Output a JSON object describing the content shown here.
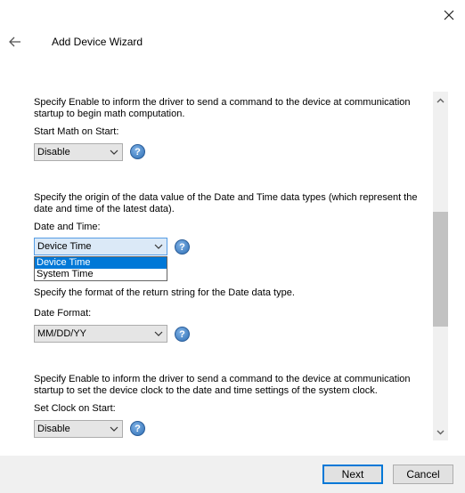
{
  "window": {
    "title": "Add Device Wizard"
  },
  "sections": [
    {
      "description": "Specify Enable to inform the driver to send a command to the device at communication startup to begin math computation.",
      "label": "Start Math on Start:",
      "value": "Disable"
    },
    {
      "description": "Specify the origin of the data value of the Date and Time data types (which represent the date and time of the latest data).",
      "label": "Date and Time:",
      "value": "Device Time",
      "options": [
        "Device Time",
        "System Time"
      ]
    },
    {
      "description": "Specify the format of the return string for the Date data type.",
      "label": "Date Format:",
      "value": "MM/DD/YY"
    },
    {
      "description": "Specify Enable to inform the driver to send a command to the device at communication startup to set the device clock to the date and time settings of the system clock.",
      "label": "Set Clock on Start:",
      "value": "Disable"
    }
  ],
  "help_glyph": "?",
  "buttons": {
    "next": "Next",
    "cancel": "Cancel"
  },
  "icons": {
    "close": "close-icon",
    "back": "back-arrow-icon",
    "help": "help-icon",
    "chevron": "chevron-down-icon"
  },
  "colors": {
    "accent": "#0078d7",
    "selection": "#0078d7"
  }
}
